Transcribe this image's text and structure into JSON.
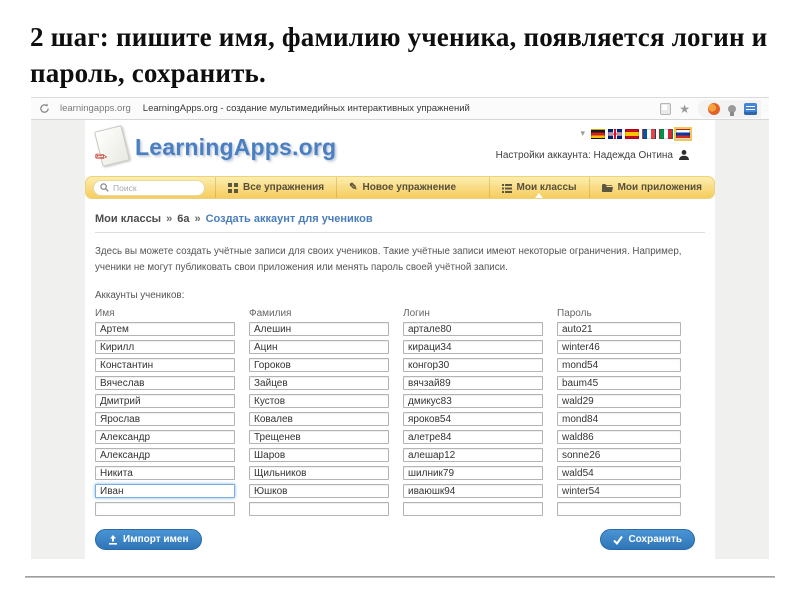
{
  "slide": {
    "title": "2 шаг: пишите имя, фамилию ученика, появляется логин и пароль, сохранить."
  },
  "browser": {
    "url": "learningapps.org",
    "page_title": "LearningApps.org - создание мультимедийных интерактивных упражнений"
  },
  "glyphs": {
    "bookmark_star": "★",
    "language_caret": "▾",
    "breadcrumb_sep": "»",
    "pencil": "✎"
  },
  "site": {
    "logo_text": "LearningApps.org",
    "account_settings": "Настройки аккаунта: Надежда Онтина",
    "flags": [
      {
        "name": "german-flag",
        "cls": "flag-de"
      },
      {
        "name": "uk-flag",
        "cls": "flag-uk"
      },
      {
        "name": "spanish-flag",
        "cls": "flag-es"
      },
      {
        "name": "french-flag",
        "cls": "flag-fr"
      },
      {
        "name": "italian-flag",
        "cls": "flag-it"
      },
      {
        "name": "russian-flag",
        "cls": "flag-ru selected"
      }
    ]
  },
  "menu": {
    "search_placeholder": "Поиск",
    "items": [
      {
        "label": "Все упражнения"
      },
      {
        "label": "Новое упражнение"
      },
      {
        "label": "Мои классы"
      },
      {
        "label": "Мои приложения"
      }
    ]
  },
  "breadcrumb": {
    "root": "Мои классы",
    "class_name": "6а",
    "current": "Создать аккаунт для учеников"
  },
  "page": {
    "description": "Здесь вы можете создать учётные записи для своих учеников. Такие учётные записи имеют некоторые ограничения. Например, ученики не могут публиковать свои приложения или менять пароль своей учётной записи.",
    "accounts_label": "Аккаунты учеников:"
  },
  "table": {
    "headers": [
      "Имя",
      "Фамилия",
      "Логин",
      "Пароль"
    ],
    "rows": [
      [
        "Артем",
        "Алешин",
        "артале80",
        "auto21"
      ],
      [
        "Кирилл",
        "Ацин",
        "кираци34",
        "winter46"
      ],
      [
        "Константин",
        "Гороков",
        "конгор30",
        "mond54"
      ],
      [
        "Вячеслав",
        "Зайцев",
        "вячзай89",
        "baum45"
      ],
      [
        "Дмитрий",
        "Кустов",
        "дмикус83",
        "wald29"
      ],
      [
        "Ярослав",
        "Ковалев",
        "яроков54",
        "mond84"
      ],
      [
        "Александр",
        "Трещенев",
        "алетре84",
        "wald86"
      ],
      [
        "Александр",
        "Шаров",
        "алешар12",
        "sonne26"
      ],
      [
        "Никита",
        "Щильников",
        "шилник79",
        "wald54"
      ],
      [
        "Иван",
        "Юшков",
        "иваюшк94",
        "winter54"
      ],
      [
        "",
        "",
        "",
        ""
      ]
    ],
    "focused_cell": {
      "row": 9,
      "col": 0
    }
  },
  "buttons": {
    "import_label": "Импорт имен",
    "save_label": "Сохранить"
  },
  "icons": [
    "reload-icon",
    "device-icon",
    "star-icon",
    "orange-extension-icon",
    "lightbulb-icon",
    "blue-extension-icon",
    "search-icon",
    "grid-icon",
    "pencil-icon",
    "list-icon",
    "folder-icon",
    "person-icon",
    "paper-pencil-logo-icon",
    "upload-icon",
    "check-icon"
  ],
  "colors": {
    "accent_blue": "#3a87c8",
    "link_blue": "#4a7ebb",
    "logo_blue": "#4b7fc0",
    "menu_yellow_top": "#fdeeae",
    "menu_yellow_bottom": "#f5cc5e",
    "focus_border": "#7aade0"
  }
}
